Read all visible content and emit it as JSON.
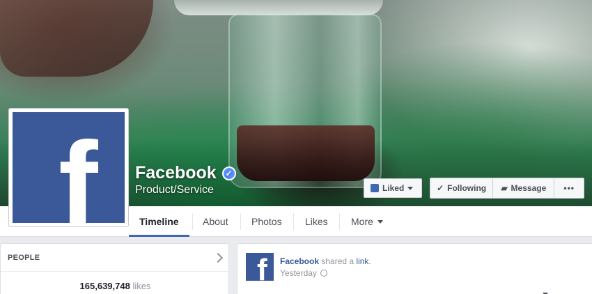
{
  "page": {
    "name": "Facebook",
    "category": "Product/Service",
    "verified_icon": "verified-badge-icon",
    "brand_color": "#3b5998"
  },
  "actions": {
    "liked_label": "Liked",
    "following_label": "Following",
    "message_label": "Message",
    "more_label": "•••"
  },
  "tabs": [
    {
      "label": "Timeline",
      "active": true
    },
    {
      "label": "About"
    },
    {
      "label": "Photos"
    },
    {
      "label": "Likes"
    },
    {
      "label": "More"
    }
  ],
  "people": {
    "title": "PEOPLE",
    "likes_count": "165,639,748",
    "likes_word": "likes"
  },
  "post": {
    "author": "Facebook",
    "shared_text": "shared a",
    "link_text": "link",
    "period": ".",
    "time": "Yesterday"
  },
  "logo_letter": "f"
}
